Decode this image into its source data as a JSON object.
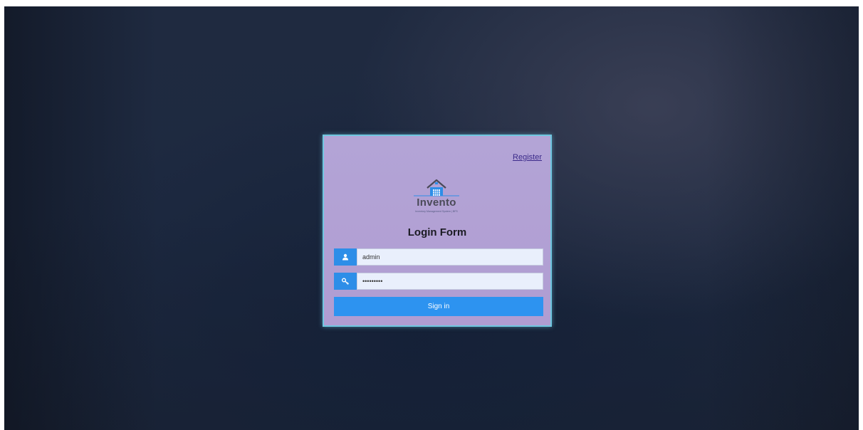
{
  "login": {
    "register_link": "Register",
    "logo": {
      "name": "Invento",
      "tagline": "Inventory Management System | BFS"
    },
    "title": "Login Form",
    "username": {
      "value": "admin",
      "icon": "user-icon"
    },
    "password": {
      "value": "secretpwd",
      "icon": "key-icon"
    },
    "submit_label": "Sign in"
  },
  "colors": {
    "background": "#1e2a41",
    "card": "#b09dd2",
    "card_border": "#6fc7e0",
    "accent": "#2d8ee8",
    "input_bg": "#e9effc",
    "link": "#3b2a8a"
  }
}
